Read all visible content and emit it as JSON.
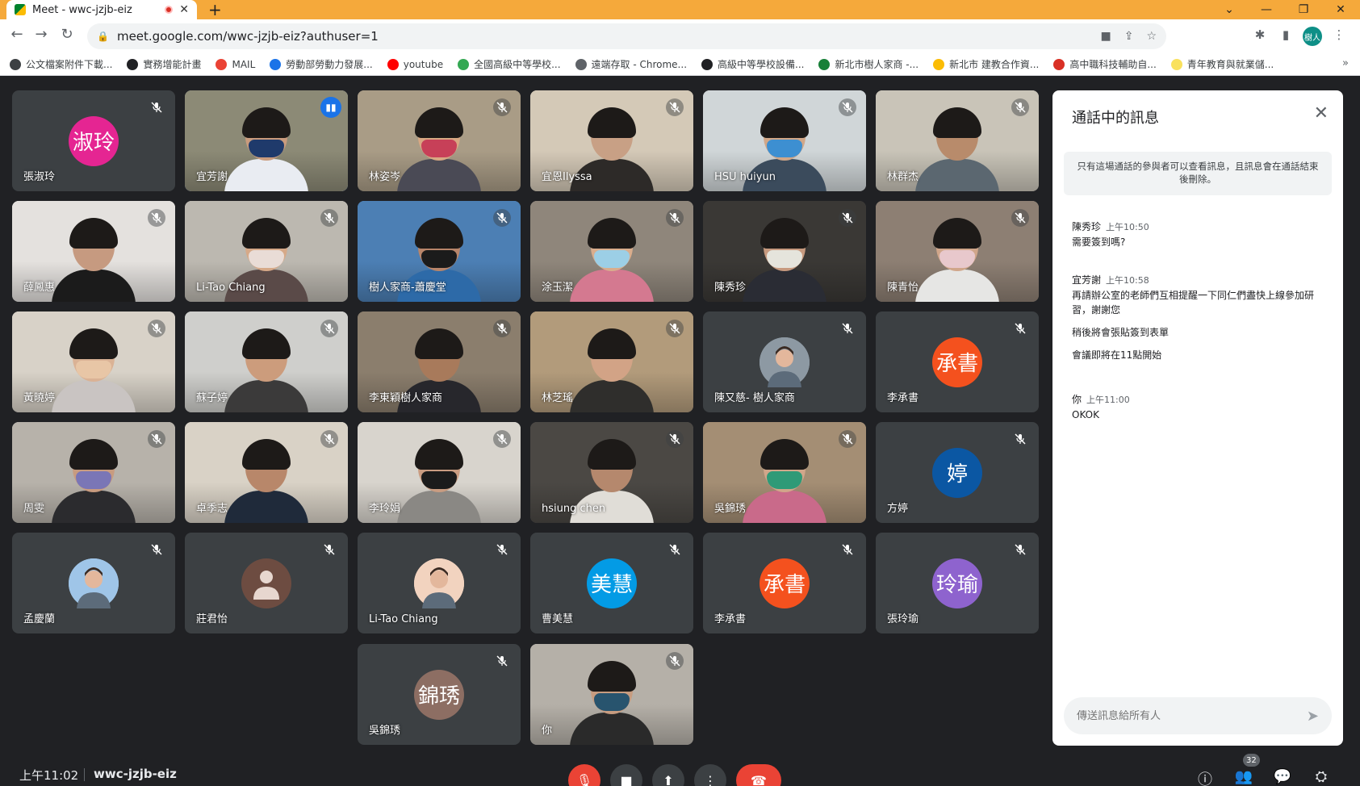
{
  "browser": {
    "tab_title": "Meet - wwc-jzjb-eiz",
    "url": "meet.google.com/wwc-jzjb-eiz?authuser=1",
    "profile_label": "樹人",
    "bookmarks": [
      {
        "label": "公文檔案附件下載...",
        "color": "#3c4043"
      },
      {
        "label": "實務增能計畫",
        "color": "#202124"
      },
      {
        "label": "MAIL",
        "color": "#ea4335"
      },
      {
        "label": "勞動部勞動力發展...",
        "color": "#1a73e8"
      },
      {
        "label": "youtube",
        "color": "#ff0000"
      },
      {
        "label": "全國高級中等學校...",
        "color": "#34a853"
      },
      {
        "label": "遠端存取 - Chrome...",
        "color": "#5f6368"
      },
      {
        "label": "高級中等學校設備...",
        "color": "#202124"
      },
      {
        "label": "新北市樹人家商 -...",
        "color": "#188038"
      },
      {
        "label": "新北市 建教合作資...",
        "color": "#fbbc04"
      },
      {
        "label": "高中職科技輔助自...",
        "color": "#d93025"
      },
      {
        "label": "青年教育與就業儲...",
        "color": "#f9e15d"
      }
    ],
    "more_glyph": "»"
  },
  "participants": [
    {
      "name": "張淑玲",
      "type": "avatar",
      "initials": "淑玲",
      "color": "#e52592"
    },
    {
      "name": "宜芳謝",
      "type": "video",
      "bg": "#8c8a76",
      "skin": "#c99b7d",
      "mask": "#1f3a6b",
      "shirt": "#e9ecf2",
      "speaking": true
    },
    {
      "name": "林姿岑",
      "type": "video",
      "bg": "#a99c86",
      "skin": "#d8a883",
      "mask": "#c74058",
      "shirt": "#4a4a55"
    },
    {
      "name": "宜恩Ilyssa",
      "type": "video",
      "bg": "#d4c9b7",
      "skin": "#c8a085",
      "mask": "",
      "shirt": "#2d2a28"
    },
    {
      "name": "HSU huiyun",
      "type": "video",
      "bg": "#d0d6d8",
      "skin": "#d1a788",
      "mask": "#3d8fd1",
      "shirt": "#3b4b5c"
    },
    {
      "name": "林群杰",
      "type": "video",
      "bg": "#c9c4b8",
      "skin": "#b88b6b",
      "mask": "",
      "shirt": "#5b6770"
    },
    {
      "name": "薛鳳惠",
      "type": "video",
      "bg": "#e4e1de",
      "skin": "#c69a80",
      "mask": "",
      "shirt": "#1b1b1b"
    },
    {
      "name": "Li-Tao Chiang",
      "type": "video",
      "bg": "#bcb8b0",
      "skin": "#d6a988",
      "mask": "#e9dcd6",
      "shirt": "#5a4a48"
    },
    {
      "name": "樹人家商-蕭慶堂",
      "type": "video",
      "bg": "#4c7fb4",
      "skin": "#b8856a",
      "mask": "#1b1b1b",
      "shirt": "#2d6aa8"
    },
    {
      "name": "涂玉潔",
      "type": "video",
      "bg": "#8f867b",
      "skin": "#d9ad8d",
      "mask": "#9ccfe6",
      "shirt": "#d47990"
    },
    {
      "name": "陳秀珍",
      "type": "video",
      "bg": "#3a3835",
      "skin": "#c79a7f",
      "mask": "#e5e4dc",
      "shirt": "#2a2c34"
    },
    {
      "name": "陳青怡",
      "type": "video",
      "bg": "#8d7f73",
      "skin": "#d0a68a",
      "mask": "#e8c8cc",
      "shirt": "#e6e6e4"
    },
    {
      "name": "黃曉婷",
      "type": "video",
      "bg": "#d8d2c8",
      "skin": "#dab295",
      "mask": "#e8c6a6",
      "shirt": "#c9c4c2"
    },
    {
      "name": "蘇子婷",
      "type": "video",
      "bg": "#cfcfcc",
      "skin": "#cc9c7c",
      "mask": "",
      "shirt": "#3b3a3a"
    },
    {
      "name": "李東穎樹人家商",
      "type": "video",
      "bg": "#8b7e6d",
      "skin": "#a87a5b",
      "mask": "",
      "shirt": "#27272c"
    },
    {
      "name": "林芝瑤",
      "type": "video",
      "bg": "#b29b7b",
      "skin": "#d2a386",
      "mask": "",
      "shirt": "#2f2e2c"
    },
    {
      "name": "陳又慈- 樹人家商",
      "type": "avatar",
      "initials": "",
      "color": "#8d99a3",
      "photo": true
    },
    {
      "name": "李承書",
      "type": "avatar",
      "initials": "承書",
      "color": "#f4511e"
    },
    {
      "name": "周雯",
      "type": "video",
      "bg": "#b7b2aa",
      "skin": "#c89b7f",
      "mask": "#7a76b6",
      "shirt": "#2b2b2e"
    },
    {
      "name": "卓季志",
      "type": "video",
      "bg": "#d9d2c6",
      "skin": "#b8876a",
      "mask": "",
      "shirt": "#1f2a3a"
    },
    {
      "name": "李玲娟",
      "type": "video",
      "bg": "#d8d4cd",
      "skin": "#c99c81",
      "mask": "#1b1b1b",
      "shirt": "#8a8884"
    },
    {
      "name": "hsiung chen",
      "type": "video",
      "bg": "#4b4844",
      "skin": "#b5886d",
      "mask": "",
      "shirt": "#e0ddd7"
    },
    {
      "name": "吳錦琇",
      "type": "video",
      "bg": "#a48e74",
      "skin": "#d1a68a",
      "mask": "#2f9a77",
      "shirt": "#c96a8a"
    },
    {
      "name": "方婷",
      "type": "avatar",
      "initials": "婷",
      "color": "#0b57a3"
    },
    {
      "name": "孟慶蘭",
      "type": "avatar",
      "initials": "",
      "color": "#9fc5e8",
      "photo": true
    },
    {
      "name": "莊君怡",
      "type": "avatar",
      "initials": "",
      "color": "#6d4c41",
      "silhouette": true
    },
    {
      "name": "Li-Tao Chiang",
      "type": "avatar",
      "initials": "",
      "color": "#f2d3bf",
      "photo": true
    },
    {
      "name": "曹美慧",
      "type": "avatar",
      "initials": "美慧",
      "color": "#039be5"
    },
    {
      "name": "李承書",
      "type": "avatar",
      "initials": "承書",
      "color": "#f4511e"
    },
    {
      "name": "張玲瑜",
      "type": "avatar",
      "initials": "玲瑜",
      "color": "#8e63ce"
    },
    {
      "name": "吳錦琇",
      "type": "avatar",
      "initials": "錦琇",
      "color": "#8d6e63"
    },
    {
      "name": "你",
      "type": "video",
      "bg": "#b5b0a8",
      "skin": "#c79c80",
      "mask": "#28546e",
      "shirt": "#2a2a2a"
    }
  ],
  "chat": {
    "title": "通話中的訊息",
    "notice": "只有這場通話的參與者可以查看訊息，且訊息會在通話結束後刪除。",
    "messages": [
      {
        "sender": "陳秀珍",
        "time": "上午10:50",
        "lines": [
          "需要簽到嗎?"
        ]
      },
      {
        "sender": "宜芳謝",
        "time": "上午10:58",
        "lines": [
          "再請辦公室的老師們互相提醒一下同仁們盡快上線參加研習，謝謝您",
          "稍後將會張貼簽到表單",
          "會議即將在11點開始"
        ]
      },
      {
        "sender": "你",
        "time": "上午11:00",
        "lines": [
          "OKOK"
        ]
      }
    ],
    "compose_placeholder": "傳送訊息給所有人"
  },
  "bottom": {
    "clock": "上午11:02",
    "meeting_code": "wwc-jzjb-eiz",
    "participant_count": "32"
  },
  "colors": {
    "background": "#202124",
    "tile": "#3c4043",
    "hangup": "#ea4335",
    "speaking_outline": "#8ab4f8",
    "tab_strip": "#f5a93b"
  }
}
